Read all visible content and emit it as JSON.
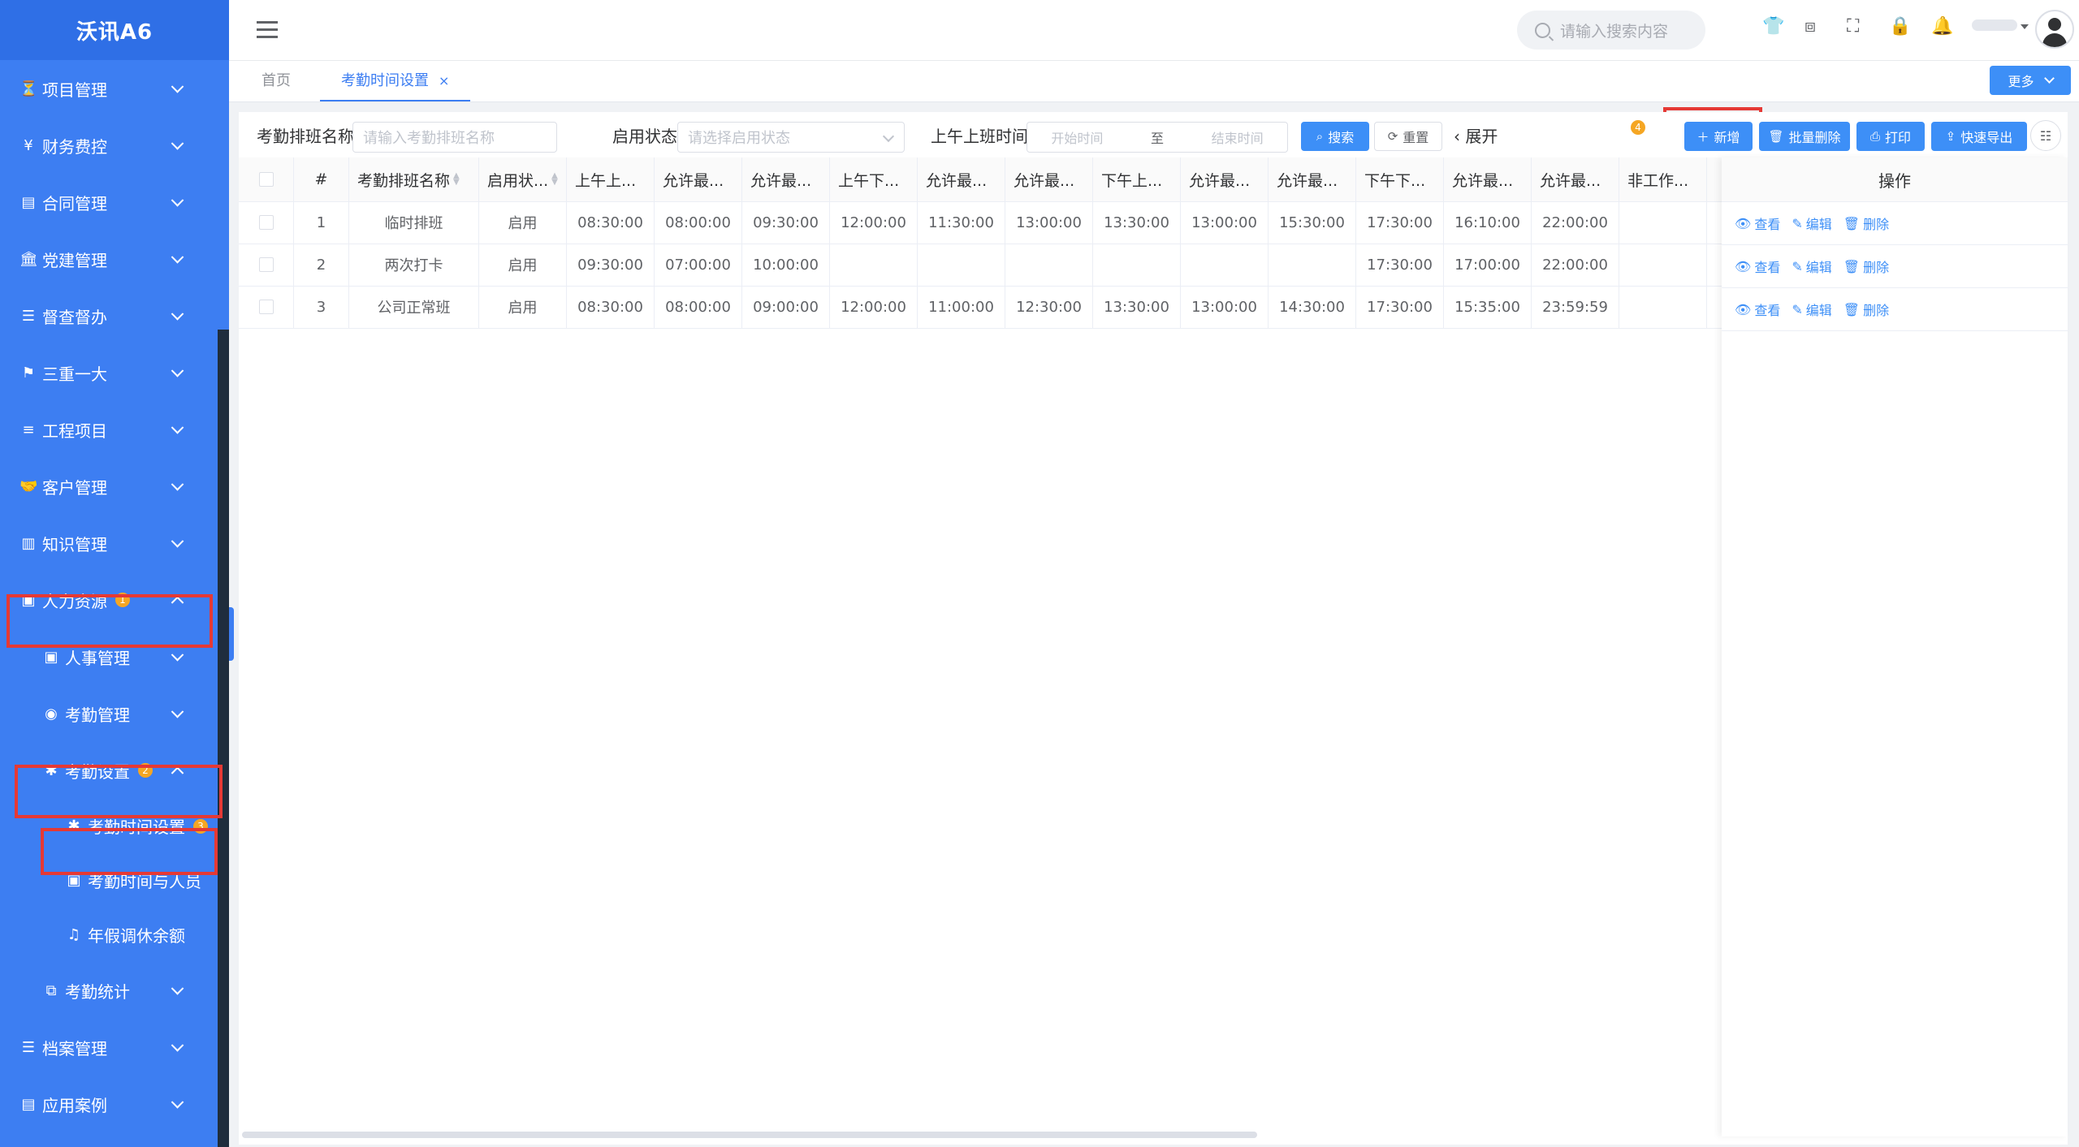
{
  "app": {
    "logo": "沃讯A6"
  },
  "sidebar": {
    "items": [
      {
        "label": "项目管理",
        "icon": "hourglass-icon",
        "glyph": "⏳",
        "level": 1,
        "arrow": "down"
      },
      {
        "label": "财务费控",
        "icon": "yen-icon",
        "glyph": "¥",
        "level": 1,
        "arrow": "down"
      },
      {
        "label": "合同管理",
        "icon": "file-icon",
        "glyph": "▤",
        "level": 1,
        "arrow": "down"
      },
      {
        "label": "党建管理",
        "icon": "bank-icon",
        "glyph": "🏛",
        "level": 1,
        "arrow": "down"
      },
      {
        "label": "督查督办",
        "icon": "list-icon",
        "glyph": "☰",
        "level": 1,
        "arrow": "down"
      },
      {
        "label": "三重一大",
        "icon": "flag-icon",
        "glyph": "⚑",
        "level": 1,
        "arrow": "down"
      },
      {
        "label": "工程项目",
        "icon": "bars-icon",
        "glyph": "≡",
        "level": 1,
        "arrow": "down"
      },
      {
        "label": "客户管理",
        "icon": "handshake-icon",
        "glyph": "🤝",
        "level": 1,
        "arrow": "down"
      },
      {
        "label": "知识管理",
        "icon": "book-icon",
        "glyph": "▥",
        "level": 1,
        "arrow": "down"
      },
      {
        "label": "人力资源",
        "icon": "person-card-icon",
        "glyph": "▣",
        "level": 1,
        "arrow": "up",
        "badge": "1"
      },
      {
        "label": "人事管理",
        "icon": "person-card-icon",
        "glyph": "▣",
        "level": 2,
        "arrow": "down"
      },
      {
        "label": "考勤管理",
        "icon": "user-circle-icon",
        "glyph": "◉",
        "level": 2,
        "arrow": "down"
      },
      {
        "label": "考勤设置",
        "icon": "asterisk-icon",
        "glyph": "✱",
        "level": 2,
        "arrow": "up",
        "badge": "2"
      },
      {
        "label": "考勤时间设置",
        "icon": "asterisk-icon",
        "glyph": "✱",
        "level": 3,
        "badge": "3"
      },
      {
        "label": "考勤时间与人员",
        "icon": "person-card-icon",
        "glyph": "▣",
        "level": 3
      },
      {
        "label": "年假调休余额",
        "icon": "music-note-icon",
        "glyph": "♫",
        "level": 3
      },
      {
        "label": "考勤统计",
        "icon": "copy-icon",
        "glyph": "⧉",
        "level": 2,
        "arrow": "down"
      },
      {
        "label": "档案管理",
        "icon": "list-icon",
        "glyph": "☰",
        "level": 1,
        "arrow": "down"
      },
      {
        "label": "应用案例",
        "icon": "file-icon",
        "glyph": "▤",
        "level": 1,
        "arrow": "down"
      }
    ]
  },
  "header": {
    "search_placeholder": "请输入搜索内容",
    "icons": [
      "tshirt-icon",
      "translate-icon",
      "fullscreen-icon",
      "lock-icon",
      "bell-icon"
    ]
  },
  "tabs": {
    "items": [
      {
        "label": "首页",
        "closable": false
      },
      {
        "label": "考勤时间设置",
        "closable": true,
        "close": "×"
      }
    ],
    "more": "更多"
  },
  "filters": {
    "name_label": "考勤排班名称",
    "name_placeholder": "请输入考勤排班名称",
    "status_label": "启用状态",
    "status_placeholder": "请选择启用状态",
    "time_label": "上午上班时间",
    "start_placeholder": "开始时间",
    "range_sep": "至",
    "end_placeholder": "结束时间",
    "search_btn": "搜索",
    "reset_btn": "重置",
    "expand": "展开"
  },
  "toolbar": {
    "badge": "4",
    "add": "新增",
    "batch_delete": "批量删除",
    "print": "打印",
    "export": "快速导出"
  },
  "table": {
    "columns": [
      "#",
      "考勤排班名称",
      "启用状...",
      "上午上...",
      "允许最...",
      "允许最...",
      "上午下...",
      "允许最...",
      "允许最...",
      "下午上...",
      "允许最...",
      "允许最...",
      "下午下...",
      "允许最...",
      "允许最...",
      "非工作..."
    ],
    "ops_header": "操作",
    "rows": [
      [
        "1",
        "临时排班",
        "启用",
        "08:30:00",
        "08:00:00",
        "09:30:00",
        "12:00:00",
        "11:30:00",
        "13:00:00",
        "13:30:00",
        "13:00:00",
        "15:30:00",
        "17:30:00",
        "16:10:00",
        "22:00:00",
        ""
      ],
      [
        "2",
        "两次打卡",
        "启用",
        "09:30:00",
        "07:00:00",
        "10:00:00",
        "",
        "",
        "",
        "",
        "",
        "",
        "17:30:00",
        "17:00:00",
        "22:00:00",
        ""
      ],
      [
        "3",
        "公司正常班",
        "启用",
        "08:30:00",
        "08:00:00",
        "09:00:00",
        "12:00:00",
        "11:00:00",
        "12:30:00",
        "13:30:00",
        "13:00:00",
        "14:30:00",
        "17:30:00",
        "15:35:00",
        "23:59:59",
        ""
      ]
    ],
    "row_actions": {
      "view": "查看",
      "edit": "编辑",
      "delete": "删除"
    }
  },
  "colors": {
    "sidebar": "#3d7ef2",
    "primary": "#3d8ff7",
    "highlight": "#e53935",
    "badge": "#f5a623"
  }
}
